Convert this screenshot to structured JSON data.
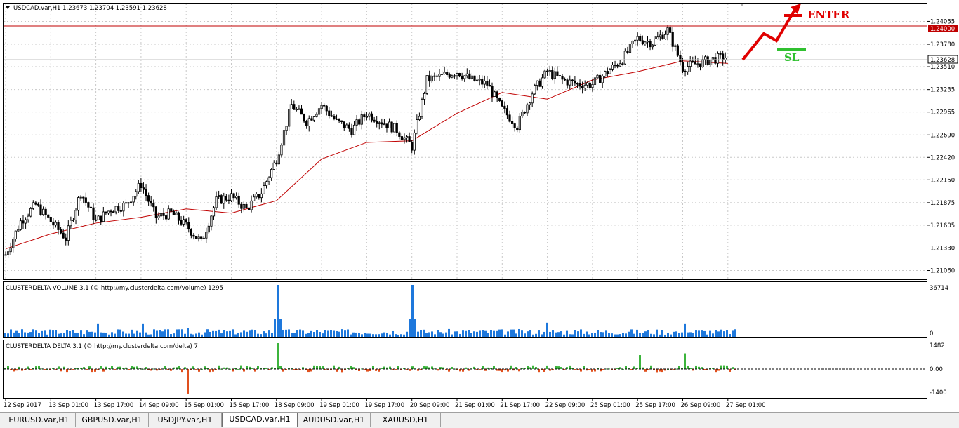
{
  "window": {
    "symbol_header": "USDCAD.var,H1  1.23673 1.23704 1.23591 1.23628"
  },
  "price_axis": {
    "labels": [
      "1.24055",
      "1.23780",
      "1.23510",
      "1.23235",
      "1.22965",
      "1.22690",
      "1.22420",
      "1.22150",
      "1.21875",
      "1.21605",
      "1.21330",
      "1.21060"
    ],
    "current_price": "1.23628",
    "level_price": "1.24000"
  },
  "time_axis": {
    "labels": [
      "12 Sep 2017",
      "13 Sep 01:00",
      "13 Sep 17:00",
      "14 Sep 09:00",
      "15 Sep 01:00",
      "15 Sep 17:00",
      "18 Sep 09:00",
      "19 Sep 01:00",
      "19 Sep 17:00",
      "20 Sep 09:00",
      "21 Sep 01:00",
      "21 Sep 17:00",
      "22 Sep 09:00",
      "25 Sep 01:00",
      "25 Sep 17:00",
      "26 Sep 09:00",
      "27 Sep 01:00"
    ]
  },
  "annotations": {
    "enter": "ENTER",
    "sl": "SL"
  },
  "volume_panel": {
    "title": "CLUSTERDELTA VOLUME 3.1 (© http://my.clusterdelta.com/volume) 1295",
    "axis_max": "36714",
    "axis_min": "0"
  },
  "delta_panel": {
    "title": "CLUSTERDELTA DELTA 3.1 (© http://my.clusterdelta.com/delta) 7",
    "axis_labels": [
      "1482",
      "0.00",
      "-1400"
    ]
  },
  "tabs": [
    {
      "label": "EURUSD.var,H1",
      "active": false
    },
    {
      "label": "GBPUSD.var,H1",
      "active": false
    },
    {
      "label": "USDJPY.var,H1",
      "active": false
    },
    {
      "label": "USDCAD.var,H1",
      "active": true
    },
    {
      "label": "AUDUSD.var,H1",
      "active": false
    },
    {
      "label": "XAUUSD,H1",
      "active": false
    }
  ],
  "colors": {
    "bull_delta": "#3cb43c",
    "bear_delta": "#e0501e",
    "volume": "#1e78dc",
    "ma": "#c00000",
    "level": "#c00000",
    "arrow": "#e00000",
    "sl": "#30c030"
  },
  "chart_data": {
    "type": "candlestick",
    "symbol": "USDCAD.var",
    "timeframe": "H1",
    "ohlc_last": {
      "open": 1.23673,
      "high": 1.23704,
      "low": 1.23591,
      "close": 1.23628
    },
    "ylim": [
      1.2098,
      1.2416
    ],
    "horizontal_level": 1.24,
    "close_path": [
      [
        "12 Sep 2017",
        1.2125
      ],
      [
        "12 Sep 2017",
        1.2165
      ],
      [
        "12 Sep 2017",
        1.2185
      ],
      [
        "13 Sep 01:00",
        1.2165
      ],
      [
        "13 Sep 01:00",
        1.2145
      ],
      [
        "13 Sep 01:00",
        1.22
      ],
      [
        "13 Sep 17:00",
        1.2165
      ],
      [
        "13 Sep 17:00",
        1.218
      ],
      [
        "13 Sep 17:00",
        1.2185
      ],
      [
        "14 Sep 09:00",
        1.221
      ],
      [
        "14 Sep 09:00",
        1.217
      ],
      [
        "14 Sep 09:00",
        1.2175
      ],
      [
        "15 Sep 01:00",
        1.216
      ],
      [
        "15 Sep 01:00",
        1.214
      ],
      [
        "15 Sep 01:00",
        1.219
      ],
      [
        "15 Sep 17:00",
        1.2195
      ],
      [
        "15 Sep 17:00",
        1.218
      ],
      [
        "15 Sep 17:00",
        1.22
      ],
      [
        "18 Sep 09:00",
        1.224
      ],
      [
        "18 Sep 09:00",
        1.2305
      ],
      [
        "18 Sep 09:00",
        1.2285
      ],
      [
        "19 Sep 01:00",
        1.2305
      ],
      [
        "19 Sep 01:00",
        1.2285
      ],
      [
        "19 Sep 01:00",
        1.2275
      ],
      [
        "19 Sep 17:00",
        1.2295
      ],
      [
        "19 Sep 17:00",
        1.2285
      ],
      [
        "19 Sep 17:00",
        1.2275
      ],
      [
        "20 Sep 09:00",
        1.2255
      ],
      [
        "20 Sep 09:00",
        1.2335
      ],
      [
        "20 Sep 09:00",
        1.234
      ],
      [
        "21 Sep 01:00",
        1.2345
      ],
      [
        "21 Sep 01:00",
        1.2335
      ],
      [
        "21 Sep 01:00",
        1.233
      ],
      [
        "21 Sep 17:00",
        1.23
      ],
      [
        "21 Sep 17:00",
        1.228
      ],
      [
        "21 Sep 17:00",
        1.232
      ],
      [
        "22 Sep 09:00",
        1.2345
      ],
      [
        "22 Sep 09:00",
        1.2335
      ],
      [
        "22 Sep 09:00",
        1.233
      ],
      [
        "25 Sep 01:00",
        1.233
      ],
      [
        "25 Sep 01:00",
        1.2345
      ],
      [
        "25 Sep 01:00",
        1.236
      ],
      [
        "25 Sep 17:00",
        1.2385
      ],
      [
        "25 Sep 17:00",
        1.238
      ],
      [
        "25 Sep 17:00",
        1.2395
      ],
      [
        "26 Sep 09:00",
        1.235
      ],
      [
        "26 Sep 09:00",
        1.2355
      ],
      [
        "26 Sep 09:00",
        1.236
      ],
      [
        "27 Sep 01:00",
        1.2363
      ]
    ],
    "moving_average": [
      [
        "12 Sep 2017",
        1.2132
      ],
      [
        "13 Sep 01:00",
        1.215
      ],
      [
        "13 Sep 17:00",
        1.2163
      ],
      [
        "14 Sep 09:00",
        1.217
      ],
      [
        "15 Sep 01:00",
        1.218
      ],
      [
        "15 Sep 17:00",
        1.2175
      ],
      [
        "18 Sep 09:00",
        1.219
      ],
      [
        "19 Sep 01:00",
        1.224
      ],
      [
        "19 Sep 17:00",
        1.226
      ],
      [
        "20 Sep 09:00",
        1.2262
      ],
      [
        "21 Sep 01:00",
        1.2295
      ],
      [
        "21 Sep 17:00",
        1.232
      ],
      [
        "22 Sep 09:00",
        1.2312
      ],
      [
        "25 Sep 01:00",
        1.2335
      ],
      [
        "25 Sep 17:00",
        1.2345
      ],
      [
        "26 Sep 09:00",
        1.2358
      ],
      [
        "27 Sep 01:00",
        1.2355
      ]
    ],
    "volume_spikes": [
      [
        "13 Sep 17:00",
        9000
      ],
      [
        "14 Sep 09:00",
        9000
      ],
      [
        "15 Sep 01:00",
        6000
      ],
      [
        "18 Sep 09:00",
        36714
      ],
      [
        "20 Sep 09:00",
        36714
      ],
      [
        "22 Sep 09:00",
        10000
      ],
      [
        "26 Sep 09:00",
        9000
      ]
    ],
    "delta_extremes": [
      [
        "18 Sep 09:00",
        1482
      ],
      [
        "15 Sep 01:00",
        -1400
      ],
      [
        "26 Sep 09:00",
        900
      ],
      [
        "25 Sep 17:00",
        800
      ]
    ]
  }
}
